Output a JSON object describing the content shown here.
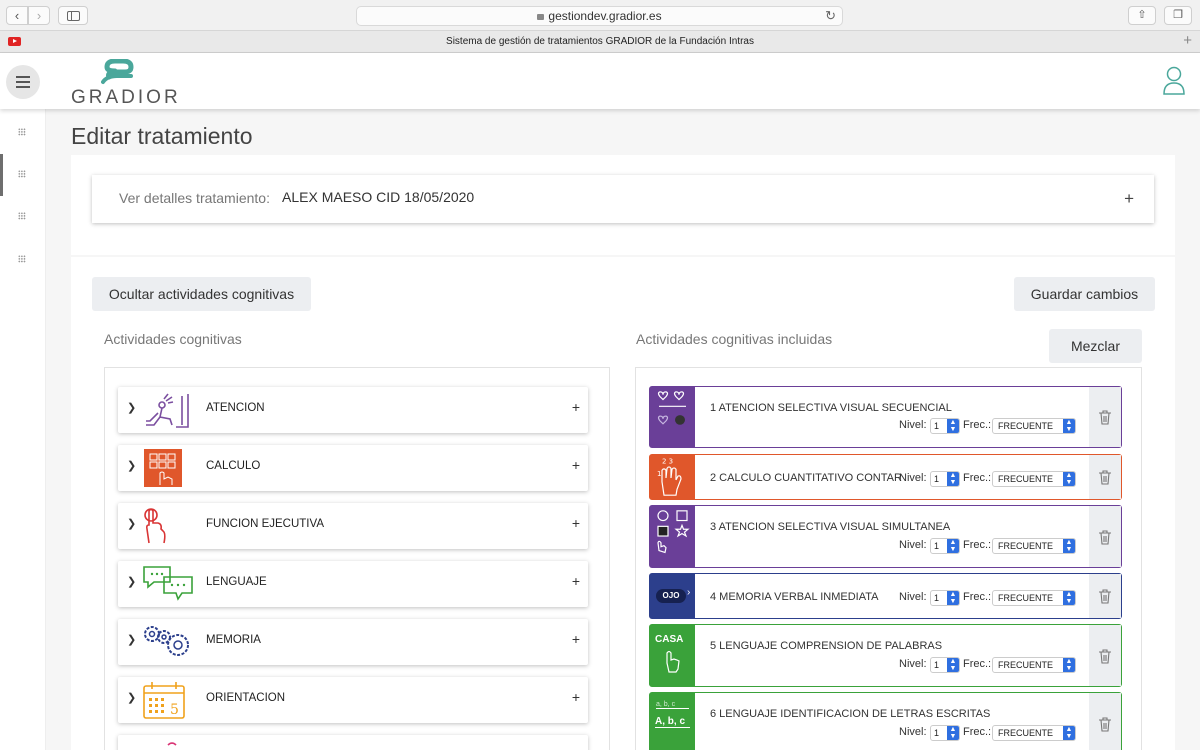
{
  "browser": {
    "url": "gestiondev.gradior.es",
    "tab_title": "Sistema de gestión de tratamientos GRADIOR de la Fundación Intras"
  },
  "app": {
    "logo_text": "GRADIOR",
    "brand_color": "#4aa79b"
  },
  "page": {
    "title": "Editar tratamiento",
    "details_label": "Ver detalles tratamiento:",
    "details_value": "ALEX MAESO CID 18/05/2020",
    "details_toggle": "+"
  },
  "buttons": {
    "hide_activities": "Ocultar actividades cognitivas",
    "save_changes": "Guardar cambios",
    "shuffle": "Mezclar"
  },
  "left": {
    "title": "Actividades cognitivas",
    "categories": [
      {
        "label": "ATENCION",
        "icon": "attention-icon",
        "color": "#7b4fa0"
      },
      {
        "label": "CALCULO",
        "icon": "calculation-icon",
        "color": "#e0572b"
      },
      {
        "label": "FUNCION EJECUTIVA",
        "icon": "executive-function-icon",
        "color": "#d93535"
      },
      {
        "label": "LENGUAJE",
        "icon": "language-icon",
        "color": "#3aa23a"
      },
      {
        "label": "MEMORIA",
        "icon": "memory-icon",
        "color": "#2c3f8c"
      },
      {
        "label": "ORIENTACION",
        "icon": "orientation-icon",
        "color": "#f0a21c"
      }
    ]
  },
  "right": {
    "title": "Actividades cognitivas incluidas",
    "nivel_label": "Nivel:",
    "frec_label": "Frec.:",
    "activities": [
      {
        "label": "1 ATENCION SELECTIVA VISUAL SECUENCIAL",
        "nivel": "1",
        "frec": "FRECUENTE",
        "color": "#6a3f98"
      },
      {
        "label": "2 CALCULO CUANTITATIVO CONTAR",
        "nivel": "1",
        "frec": "FRECUENTE",
        "color": "#e0572b"
      },
      {
        "label": "3 ATENCION SELECTIVA VISUAL SIMULTANEA",
        "nivel": "1",
        "frec": "FRECUENTE",
        "color": "#6a3f98"
      },
      {
        "label": "4 MEMORIA VERBAL INMEDIATA",
        "nivel": "1",
        "frec": "FRECUENTE",
        "color": "#2c3f8c",
        "icon_text": "OJO"
      },
      {
        "label": "5 LENGUAJE COMPRENSION DE PALABRAS",
        "nivel": "1",
        "frec": "FRECUENTE",
        "color": "#3aa23a",
        "icon_text": "CASA"
      },
      {
        "label": "6 LENGUAJE IDENTIFICACION DE LETRAS ESCRITAS",
        "nivel": "1",
        "frec": "FRECUENTE",
        "color": "#3aa23a",
        "icon_text": "A, b, c"
      }
    ]
  }
}
